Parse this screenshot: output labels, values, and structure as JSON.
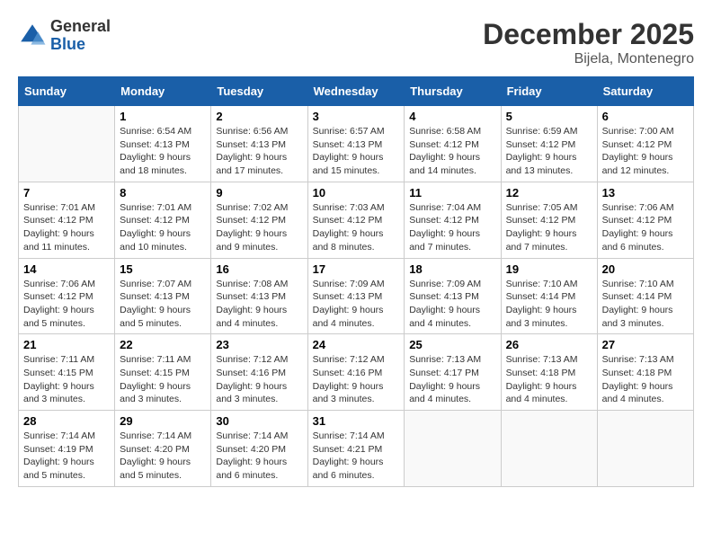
{
  "header": {
    "logo_general": "General",
    "logo_blue": "Blue",
    "month_title": "December 2025",
    "location": "Bijela, Montenegro"
  },
  "weekdays": [
    "Sunday",
    "Monday",
    "Tuesday",
    "Wednesday",
    "Thursday",
    "Friday",
    "Saturday"
  ],
  "weeks": [
    [
      {
        "day": "",
        "info": ""
      },
      {
        "day": "1",
        "info": "Sunrise: 6:54 AM\nSunset: 4:13 PM\nDaylight: 9 hours\nand 18 minutes."
      },
      {
        "day": "2",
        "info": "Sunrise: 6:56 AM\nSunset: 4:13 PM\nDaylight: 9 hours\nand 17 minutes."
      },
      {
        "day": "3",
        "info": "Sunrise: 6:57 AM\nSunset: 4:13 PM\nDaylight: 9 hours\nand 15 minutes."
      },
      {
        "day": "4",
        "info": "Sunrise: 6:58 AM\nSunset: 4:12 PM\nDaylight: 9 hours\nand 14 minutes."
      },
      {
        "day": "5",
        "info": "Sunrise: 6:59 AM\nSunset: 4:12 PM\nDaylight: 9 hours\nand 13 minutes."
      },
      {
        "day": "6",
        "info": "Sunrise: 7:00 AM\nSunset: 4:12 PM\nDaylight: 9 hours\nand 12 minutes."
      }
    ],
    [
      {
        "day": "7",
        "info": "Sunrise: 7:01 AM\nSunset: 4:12 PM\nDaylight: 9 hours\nand 11 minutes."
      },
      {
        "day": "8",
        "info": "Sunrise: 7:01 AM\nSunset: 4:12 PM\nDaylight: 9 hours\nand 10 minutes."
      },
      {
        "day": "9",
        "info": "Sunrise: 7:02 AM\nSunset: 4:12 PM\nDaylight: 9 hours\nand 9 minutes."
      },
      {
        "day": "10",
        "info": "Sunrise: 7:03 AM\nSunset: 4:12 PM\nDaylight: 9 hours\nand 8 minutes."
      },
      {
        "day": "11",
        "info": "Sunrise: 7:04 AM\nSunset: 4:12 PM\nDaylight: 9 hours\nand 7 minutes."
      },
      {
        "day": "12",
        "info": "Sunrise: 7:05 AM\nSunset: 4:12 PM\nDaylight: 9 hours\nand 7 minutes."
      },
      {
        "day": "13",
        "info": "Sunrise: 7:06 AM\nSunset: 4:12 PM\nDaylight: 9 hours\nand 6 minutes."
      }
    ],
    [
      {
        "day": "14",
        "info": "Sunrise: 7:06 AM\nSunset: 4:12 PM\nDaylight: 9 hours\nand 5 minutes."
      },
      {
        "day": "15",
        "info": "Sunrise: 7:07 AM\nSunset: 4:13 PM\nDaylight: 9 hours\nand 5 minutes."
      },
      {
        "day": "16",
        "info": "Sunrise: 7:08 AM\nSunset: 4:13 PM\nDaylight: 9 hours\nand 4 minutes."
      },
      {
        "day": "17",
        "info": "Sunrise: 7:09 AM\nSunset: 4:13 PM\nDaylight: 9 hours\nand 4 minutes."
      },
      {
        "day": "18",
        "info": "Sunrise: 7:09 AM\nSunset: 4:13 PM\nDaylight: 9 hours\nand 4 minutes."
      },
      {
        "day": "19",
        "info": "Sunrise: 7:10 AM\nSunset: 4:14 PM\nDaylight: 9 hours\nand 3 minutes."
      },
      {
        "day": "20",
        "info": "Sunrise: 7:10 AM\nSunset: 4:14 PM\nDaylight: 9 hours\nand 3 minutes."
      }
    ],
    [
      {
        "day": "21",
        "info": "Sunrise: 7:11 AM\nSunset: 4:15 PM\nDaylight: 9 hours\nand 3 minutes."
      },
      {
        "day": "22",
        "info": "Sunrise: 7:11 AM\nSunset: 4:15 PM\nDaylight: 9 hours\nand 3 minutes."
      },
      {
        "day": "23",
        "info": "Sunrise: 7:12 AM\nSunset: 4:16 PM\nDaylight: 9 hours\nand 3 minutes."
      },
      {
        "day": "24",
        "info": "Sunrise: 7:12 AM\nSunset: 4:16 PM\nDaylight: 9 hours\nand 3 minutes."
      },
      {
        "day": "25",
        "info": "Sunrise: 7:13 AM\nSunset: 4:17 PM\nDaylight: 9 hours\nand 4 minutes."
      },
      {
        "day": "26",
        "info": "Sunrise: 7:13 AM\nSunset: 4:18 PM\nDaylight: 9 hours\nand 4 minutes."
      },
      {
        "day": "27",
        "info": "Sunrise: 7:13 AM\nSunset: 4:18 PM\nDaylight: 9 hours\nand 4 minutes."
      }
    ],
    [
      {
        "day": "28",
        "info": "Sunrise: 7:14 AM\nSunset: 4:19 PM\nDaylight: 9 hours\nand 5 minutes."
      },
      {
        "day": "29",
        "info": "Sunrise: 7:14 AM\nSunset: 4:20 PM\nDaylight: 9 hours\nand 5 minutes."
      },
      {
        "day": "30",
        "info": "Sunrise: 7:14 AM\nSunset: 4:20 PM\nDaylight: 9 hours\nand 6 minutes."
      },
      {
        "day": "31",
        "info": "Sunrise: 7:14 AM\nSunset: 4:21 PM\nDaylight: 9 hours\nand 6 minutes."
      },
      {
        "day": "",
        "info": ""
      },
      {
        "day": "",
        "info": ""
      },
      {
        "day": "",
        "info": ""
      }
    ]
  ]
}
